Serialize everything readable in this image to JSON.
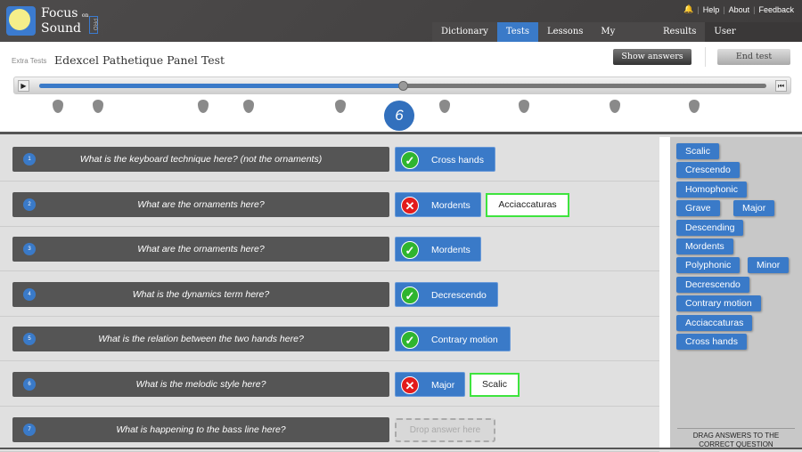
{
  "header": {
    "brand_top": "Focus",
    "brand_on": "on",
    "brand_bottom": "Sound",
    "brand_pro": "PRO",
    "links": [
      "Help",
      "About",
      "Feedback"
    ],
    "tabs": [
      {
        "label": "Dictionary"
      },
      {
        "label": "Tests",
        "active": true
      },
      {
        "label": "Lessons"
      },
      {
        "label": "My School"
      },
      {
        "label": "Results"
      },
      {
        "label": "User"
      }
    ]
  },
  "test": {
    "breadcrumb": "Extra Tests",
    "title": "Edexcel Pathetique Panel Test",
    "show_answers": "Show answers",
    "end_test": "End test",
    "progress_percent": 50,
    "current_question": "6"
  },
  "questions": [
    {
      "num": "1",
      "text": "What is the keyboard technique here? (not the ornaments)",
      "answer": "Cross hands",
      "correct": true
    },
    {
      "num": "2",
      "text": "What are the ornaments here?",
      "answer": "Mordents",
      "correct": false,
      "correct_answer": "Acciaccaturas"
    },
    {
      "num": "3",
      "text": "What are the ornaments here?",
      "answer": "Mordents",
      "correct": true
    },
    {
      "num": "4",
      "text": "What is the dynamics term here?",
      "answer": "Decrescendo",
      "correct": true
    },
    {
      "num": "5",
      "text": "What is the relation between the two hands here?",
      "answer": "Contrary motion",
      "correct": true
    },
    {
      "num": "6",
      "text": "What is the melodic style here?",
      "answer": "Major",
      "correct": false,
      "correct_answer": "Scalic"
    },
    {
      "num": "7",
      "text": "What is happening to the bass line here?",
      "placeholder": "Drop answer here"
    }
  ],
  "answer_bank": [
    "Scalic",
    "Crescendo",
    "Homophonic",
    "Grave",
    "Major",
    "Descending",
    "Mordents",
    "Polyphonic",
    "Minor",
    "Decrescendo",
    "Contrary motion",
    "Acciaccaturas",
    "Cross hands"
  ],
  "answer_bank_hint": "DRAG ANSWERS TO THE CORRECT QUESTION",
  "colors": {
    "accent": "#3a7ac8",
    "correct": "#2fb52f",
    "wrong": "#e21b1b",
    "correct_outline": "#3ee43e"
  }
}
